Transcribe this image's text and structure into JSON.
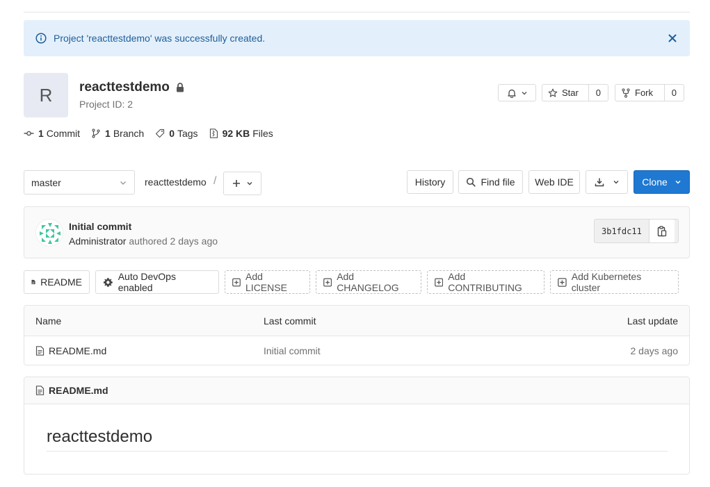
{
  "flash": {
    "message": "Project 'reacttestdemo' was successfully created."
  },
  "project": {
    "avatar_letter": "R",
    "name": "reacttestdemo",
    "id_text": "Project ID: 2",
    "star": {
      "label": "Star",
      "count": "0"
    },
    "fork": {
      "label": "Fork",
      "count": "0"
    }
  },
  "stats": {
    "commits": {
      "count": "1",
      "label": "Commit"
    },
    "branches": {
      "count": "1",
      "label": "Branch"
    },
    "tags": {
      "count": "0",
      "label": "Tags"
    },
    "files": {
      "count": "92 KB",
      "label": "Files"
    }
  },
  "toolbar": {
    "branch": "master",
    "breadcrumb": "reacttestdemo",
    "separator": "/",
    "history": "History",
    "find_file": "Find file",
    "web_ide": "Web IDE",
    "clone": "Clone"
  },
  "last_commit": {
    "title": "Initial commit",
    "author": "Administrator",
    "authored_text": "authored 2 days ago",
    "sha": "3b1fdc11"
  },
  "quick_links": {
    "readme": "README",
    "auto_devops": "Auto DevOps enabled",
    "add_license": "Add LICENSE",
    "add_changelog": "Add CHANGELOG",
    "add_contributing": "Add CONTRIBUTING",
    "add_kubernetes": "Add Kubernetes cluster"
  },
  "file_table": {
    "headers": {
      "name": "Name",
      "last_commit": "Last commit",
      "last_update": "Last update"
    },
    "rows": [
      {
        "name": "README.md",
        "last_commit": "Initial commit",
        "last_update": "2 days ago"
      }
    ]
  },
  "readme": {
    "filename": "README.md",
    "heading": "reacttestdemo"
  },
  "colors": {
    "flash_bg": "#e3f0fb",
    "flash_text": "#1f5d99",
    "primary": "#1f78d1",
    "avatar_teal": "#3fc7a0"
  }
}
